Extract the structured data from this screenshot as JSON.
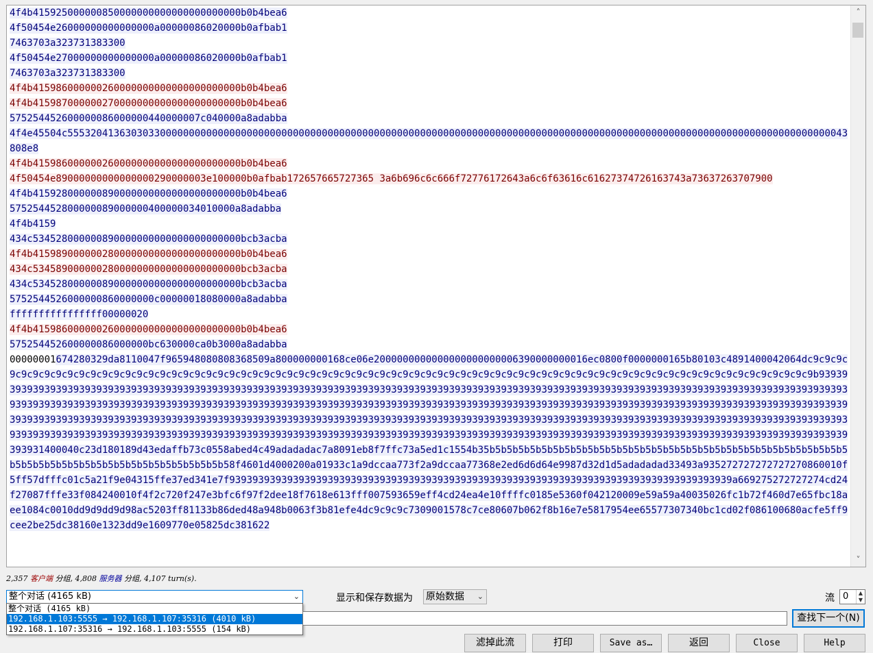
{
  "stream": {
    "segments": [
      {
        "dir": "server",
        "text": "4f4b415925000000850000000000000000000000b0b4bea6"
      },
      {
        "dir": "server",
        "text": "4f50454e26000000000000000a00000086020000b0afbab1"
      },
      {
        "dir": "server",
        "text": "7463703a323731383300"
      },
      {
        "dir": "server",
        "text": "4f50454e27000000000000000a00000086020000b0afbab1"
      },
      {
        "dir": "server",
        "text": "7463703a323731383300"
      },
      {
        "dir": "client",
        "text": "4f4b415986000000260000000000000000000000b0b4bea6"
      },
      {
        "dir": "client",
        "text": "4f4b415987000000270000000000000000000000b0b4bea6"
      },
      {
        "dir": "server",
        "text": "575254452600000086000000440000007c040000a8adabba"
      },
      {
        "dir": "server",
        "text": "4f4e45504c555320413630303300000000000000000000000000000000000000000000000000000000000000000000000000000000000000000000000000000000000000000000043808e8"
      },
      {
        "dir": "client",
        "text": "4f4b415986000000260000000000000000000000b0b4bea6"
      },
      {
        "dir": "client",
        "text": "4f50454e89000000000000000290000003e100000b0afbab172657665727365 3a6b696c6c666f72776172643a6c6f63616c61627374726163743a73637263707900"
      },
      {
        "dir": "server",
        "text": "4f4b415928000000890000000000000000000000b0b4bea6"
      },
      {
        "dir": "server",
        "text": "575254452800000089000000400000034010000a8adabba"
      },
      {
        "dir": "server",
        "text": "4f4b4159"
      },
      {
        "dir": "server",
        "text": "434c534528000000890000000000000000000000bcb3acba"
      },
      {
        "dir": "client",
        "text": "4f4b415989000000280000000000000000000000b0b4bea6"
      },
      {
        "dir": "client",
        "text": "434c534589000000280000000000000000000000bcb3acba"
      },
      {
        "dir": "server",
        "text": "434c534528000000890000000000000000000000bcb3acba"
      },
      {
        "dir": "server",
        "text": "5752544526000000860000000c00000018080000a8adabba"
      },
      {
        "dir": "server",
        "text": "ffffffffffffffff00000020"
      },
      {
        "dir": "client",
        "text": "4f4b415986000000260000000000000000000000b0b4bea6"
      },
      {
        "dir": "server",
        "text": "575254452600000086000000bc630000ca0b3000a8adabba"
      },
      {
        "dir": "mixed",
        "plain": "00000001",
        "text": "674280329da8110047f965948080808368509a800000000168ce06e2000000000000000000000006390000000016ec0800f0000000165b80103c4891400042064dc9c9c9c9c9c9c9c9c9c9c9c9c9c9c9c9c9c9c9c9c9c9c9c9c9c9c9c9c9c9c9c9c9c9c9c9c9c9c9c9c9c9c9c9c9c9c9c9c9c9c9c9c9c9c9c9c9c9c9c9c9c9c9c9c9c9c9c9c9c9c9c9c9b939393939393939393939393939393939393939393939393939393939393939393939393939393939393939393939393939393939393939393939393939393939393939393939393939393939393939393939393939393939393939393939393939393939393939393939393939393939393939393939393939393939393939393939393939393939393939393939393939393939393939393939393939393939393939393939393939393939393939393939393939393939393939393939393939393939393939393939393939393939393939393939393939393939393939393939393939393939393939393939393939393939393939393939393939393939393939393939393939393939393939393939393939393939393939393939393939393939393931400040c23d180189d43edaffb73c0558abed4c49adadadac7a8091eb8f7ffc73a5ed1c1554b35b5b5b5b5b5b5b5b5b5b5b5b5b5b5b5b5b5b5b5b5b5b5b5b5b5b5b5b5b5b5b5b5b5b5b5b5b5b5b5b5b5b5b5b5b5b5b5b5b5b58f4601d4000200a01933c1a9dccaa773f2a9dccaa77368e2ed6d6d64e9987d32d1d5adadadad33493a935272727272727270860010f5ff57dfffc01c5a21f9e04315ffe37ed341e7f939393939393939393939393939393939393939393939393939393939393939393939393939393939393939a669275272727274cd24f27087fffe33f084240010f4f2c720f247e3bfc6f97f2dee18f7618e613fff007593659eff4cd24ea4e10ffffc0185e5360f042120009e59a59a40035026fc1b72f460d7e65fbc18aee1084c0010dd9d9dd9d98ac5203ff81133b86ded48a948b0063f3b81efe4dc9c9c9c7309001578c7ce80607b062f8b16e7e5817954ee65577307340bc1cd02f086100680acfe5ff9cee2be25dc38160e1323dd9e1609770e05825dc381622"
      }
    ]
  },
  "summary": {
    "client_count": "2,357",
    "client_word": "客户端",
    "client_unit": "分组, ",
    "server_count": "4,808",
    "server_word": "服务器",
    "server_unit": "分组, ",
    "turns": "4,107 turn(s)."
  },
  "conversation": {
    "selected": "整个对话 (4165 kB)",
    "options": [
      "整个对话 (4165 kB)",
      "192.168.1.103:5555 → 192.168.1.107:35316 (4010 kB)",
      "192.168.1.107:35316 → 192.168.1.103:5555 (154 kB)"
    ],
    "highlighted_index": 1
  },
  "format": {
    "label": "显示和保存数据为",
    "value": "原始数据"
  },
  "stream_index": {
    "label": "流",
    "value": "0"
  },
  "find": {
    "value": "",
    "button": "查找下一个(N)"
  },
  "buttons": {
    "filter_out": "滤掉此流",
    "print": "打印",
    "save_as": "Save as…",
    "back": "返回",
    "close": "Close",
    "help": "Help"
  }
}
